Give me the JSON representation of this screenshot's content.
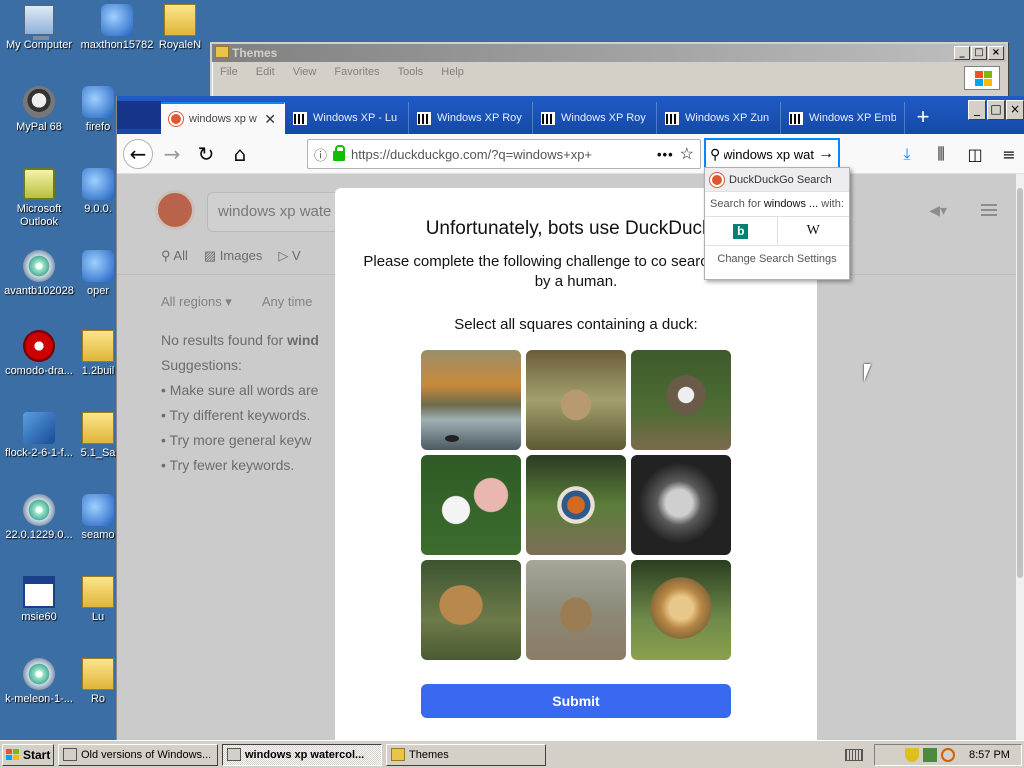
{
  "desktop": {
    "icons": [
      {
        "label": "My Computer"
      },
      {
        "label": "maxthon15782"
      },
      {
        "label": "RoyaleN"
      },
      {
        "label": "MyPal 68"
      },
      {
        "label": "firefo"
      },
      {
        "label": "Microsoft Outlook"
      },
      {
        "label": "9.0.0."
      },
      {
        "label": "avantb102028"
      },
      {
        "label": "oper"
      },
      {
        "label": "comodo-dra..."
      },
      {
        "label": "1.2buil"
      },
      {
        "label": "flock-2-6-1-f..."
      },
      {
        "label": "5.1_Sa"
      },
      {
        "label": "22.0.1229.0..."
      },
      {
        "label": "seamo"
      },
      {
        "label": "msie60"
      },
      {
        "label": "Lu"
      },
      {
        "label": "k-meleon-1-..."
      },
      {
        "label": "Ro"
      }
    ]
  },
  "themes_window": {
    "title": "Themes",
    "menu": [
      "File",
      "Edit",
      "View",
      "Favorites",
      "Tools",
      "Help"
    ]
  },
  "browser": {
    "tabs": [
      {
        "label": "windows xp w",
        "active": true
      },
      {
        "label": "Windows XP - Lu"
      },
      {
        "label": "Windows XP Roy"
      },
      {
        "label": "Windows XP Roy"
      },
      {
        "label": "Windows XP Zun"
      },
      {
        "label": "Windows XP Emb"
      }
    ],
    "url": "https://duckduckgo.com/?q=windows+xp+",
    "search_query": "windows xp wat",
    "search_popup": {
      "header": "DuckDuckGo Search",
      "search_for_prefix": "Search for",
      "search_for_term": "windows ...",
      "search_for_suffix": "with:",
      "engine_bing": "b",
      "engine_wikipedia": "W",
      "change_settings": "Change Search Settings"
    }
  },
  "page": {
    "search_value": "windows xp wate",
    "tabs": [
      "All",
      "Images",
      "V"
    ],
    "filters": [
      "All regions ▾",
      "Any time"
    ],
    "no_results_prefix": "No results found for",
    "no_results_term": "wind",
    "suggestions_label": "Suggestions:",
    "suggestions": [
      "Make sure all words are",
      "Try different keywords.",
      "Try more general keyw",
      "Try fewer keywords."
    ]
  },
  "modal": {
    "title": "Unfortunately, bots use DuckDuckG",
    "subtitle": "Please complete the following challenge to co search was made by a human.",
    "instruction": "Select all squares containing a duck:",
    "submit_label": "Submit"
  },
  "taskbar": {
    "start_label": "Start",
    "tasks": [
      {
        "label": "Old versions of Windows..."
      },
      {
        "label": "windows xp watercol...",
        "active": true
      },
      {
        "label": "Themes"
      }
    ],
    "clock": "8:57 PM"
  }
}
